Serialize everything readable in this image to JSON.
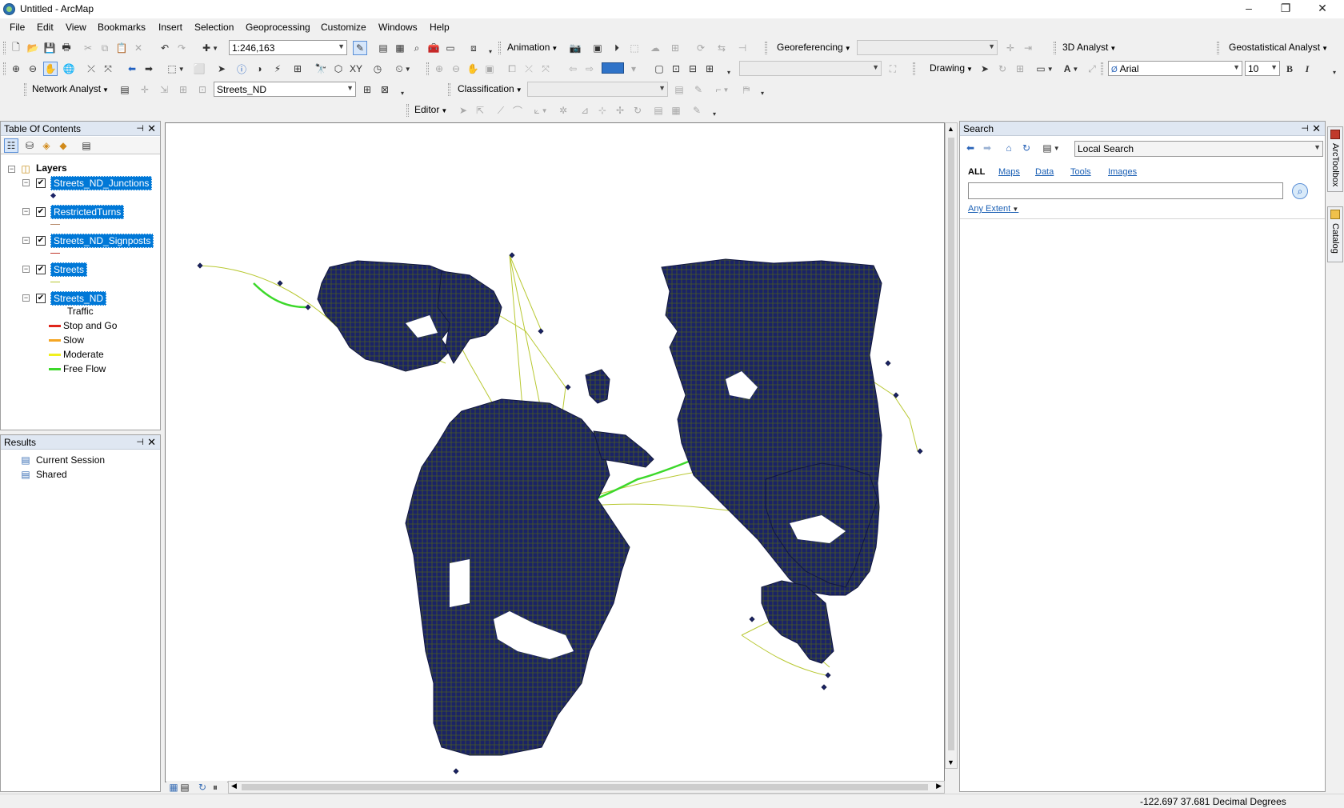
{
  "window": {
    "title": "Untitled - ArcMap",
    "controls": [
      "–",
      "❐",
      "✕"
    ]
  },
  "menu": [
    "File",
    "Edit",
    "View",
    "Bookmarks",
    "Insert",
    "Selection",
    "Geoprocessing",
    "Customize",
    "Windows",
    "Help"
  ],
  "toolbars": {
    "scale": "1:246,163",
    "animation_label": "Animation",
    "georeferencing_label": "Georeferencing",
    "analyst3d_label": "3D Analyst",
    "geostat_label": "Geostatistical Analyst",
    "drawing_label": "Drawing",
    "font_name": "Arial",
    "font_size": "10",
    "bold_label": "B",
    "italic_label": "I",
    "network_analyst_label": "Network Analyst",
    "network_layer": "Streets_ND",
    "classification_label": "Classification",
    "editor_label": "Editor"
  },
  "toc": {
    "title": "Table Of Contents",
    "pin": "⊣",
    "close": "✕",
    "root": "Layers",
    "layers": [
      {
        "name": "Streets_ND_Junctions",
        "checked": "✔"
      },
      {
        "name": "RestrictedTurns",
        "checked": "✔"
      },
      {
        "name": "Streets_ND_Signposts",
        "checked": "✔"
      },
      {
        "name": "Streets",
        "checked": "✔"
      },
      {
        "name": "Streets_ND",
        "checked": "✔"
      }
    ],
    "legend_title": "Traffic",
    "legend": [
      {
        "label": "Stop and Go",
        "color": "#e0261b"
      },
      {
        "label": "Slow",
        "color": "#f5a623"
      },
      {
        "label": "Moderate",
        "color": "#f0f01e"
      },
      {
        "label": "Free Flow",
        "color": "#3cd82a"
      }
    ]
  },
  "results": {
    "title": "Results",
    "items": [
      "Current Session",
      "Shared"
    ]
  },
  "search": {
    "title": "Search",
    "scope": "Local Search",
    "tabs": [
      "ALL",
      "Maps",
      "Data",
      "Tools",
      "Images"
    ],
    "query": "",
    "extent": "Any Extent"
  },
  "side_tabs": [
    "ArcToolbox",
    "Catalog"
  ],
  "status": {
    "coords": "-122.697  37.681 Decimal Degrees"
  },
  "colors": {
    "selection": "#0078d7",
    "junction_fill": "#1a2366",
    "street_line": "#b8c832",
    "free_flow": "#3cd82a"
  }
}
